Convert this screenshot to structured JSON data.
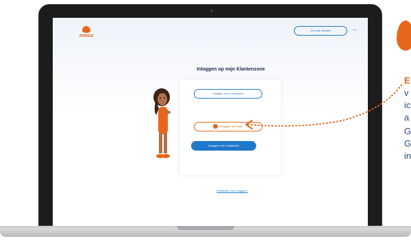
{
  "screen": {
    "logo_text": "eneco",
    "header_link_label": "Ga naar website",
    "header_more_label": "EN",
    "page_title": "Inloggen op mijn Klantenzone",
    "login_card": {
      "option1_label": "Inloggen met e-mailadres",
      "option2_label": "Inloggen met DigiD",
      "primary_label": "Inloggen met e-mailadres",
      "help_link_label": "Problemen met inloggen?"
    }
  },
  "side_text": {
    "title": "E",
    "line1": "v",
    "line2": "ic",
    "line3": "a",
    "line4": "G",
    "line5": "G",
    "line6": "in"
  },
  "colors": {
    "accent_orange": "#e8661c",
    "accent_blue": "#1f78c9",
    "title_navy": "#1b2d4f"
  },
  "icons": [
    "flame-icon",
    "digid-icon"
  ]
}
